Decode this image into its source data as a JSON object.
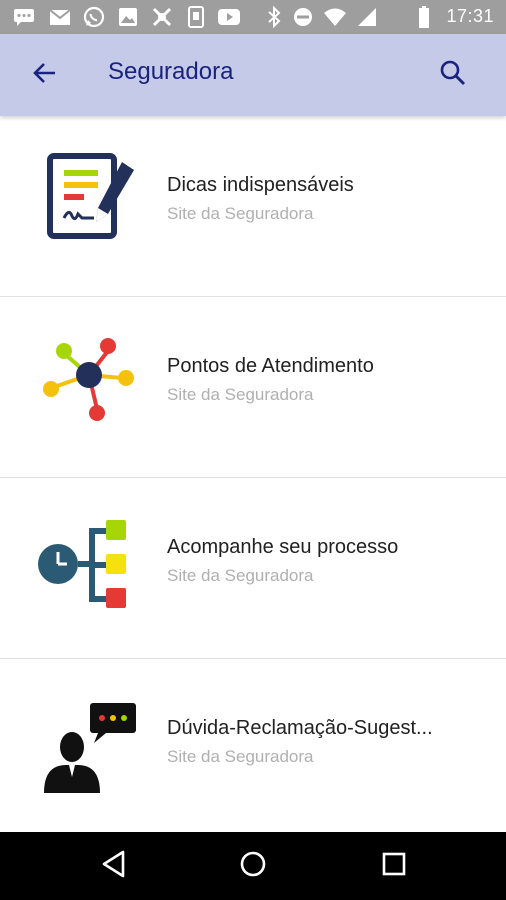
{
  "status_bar": {
    "time": "17:31",
    "icons": [
      "chat-icon",
      "gmail-icon",
      "whatsapp-icon",
      "gallery-icon",
      "app-icon",
      "app-icon-2",
      "youtube-icon",
      "bluetooth-icon",
      "do-not-disturb-icon",
      "wifi-icon",
      "cell-signal-icon",
      "battery-icon"
    ]
  },
  "app_bar": {
    "title": "Seguradora",
    "back_icon": "arrow-back-icon",
    "search_icon": "search-icon",
    "background": "#c5cae9",
    "title_color": "#1a237e"
  },
  "list": {
    "items": [
      {
        "title": "Dicas indispensáveis",
        "subtitle": "Site da Seguradora",
        "icon": "document-pen-icon"
      },
      {
        "title": "Pontos de Atendimento",
        "subtitle": "Site da Seguradora",
        "icon": "network-nodes-icon"
      },
      {
        "title": "Acompanhe seu processo",
        "subtitle": "Site da Seguradora",
        "icon": "process-timeline-icon"
      },
      {
        "title": "Dúvida-Reclamação-Sugest...",
        "subtitle": "Site da Seguradora",
        "icon": "user-chat-icon"
      }
    ]
  },
  "nav_bar": {
    "back": "nav-back-icon",
    "home": "nav-home-icon",
    "recents": "nav-recents-icon"
  }
}
